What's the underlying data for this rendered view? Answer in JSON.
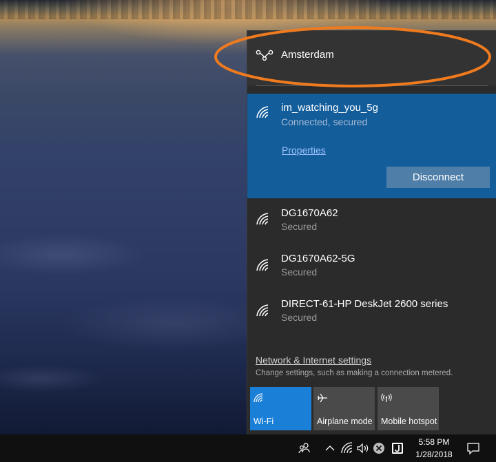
{
  "vpn": {
    "name": "Amsterdam",
    "icon": "vpn-icon"
  },
  "networks": [
    {
      "name": "im_watching_you_5g",
      "status": "Connected, secured",
      "properties_label": "Properties",
      "action_label": "Disconnect",
      "icon": "wifi-icon"
    },
    {
      "name": "DG1670A62",
      "status": "Secured",
      "icon": "wifi-icon"
    },
    {
      "name": "DG1670A62-5G",
      "status": "Secured",
      "icon": "wifi-icon"
    },
    {
      "name": "DIRECT-61-HP DeskJet 2600 series",
      "status": "Secured",
      "icon": "wifi-icon"
    }
  ],
  "settings": {
    "link": "Network & Internet settings",
    "description": "Change settings, such as making a connection metered."
  },
  "quick_actions": [
    {
      "label": "Wi-Fi",
      "icon": "wifi-icon",
      "state": "on"
    },
    {
      "label": "Airplane mode",
      "icon": "airplane-icon",
      "state": "off"
    },
    {
      "label": "Mobile hotspot",
      "icon": "hotspot-icon",
      "state": "off"
    }
  ],
  "taskbar": {
    "time": "5:58 PM",
    "date": "1/28/2018",
    "tray_icons": [
      "people-icon",
      "chevron-up-icon",
      "network-icon",
      "volume-icon",
      "x-circle-icon",
      "app-j-icon",
      "notification-icon"
    ]
  },
  "colors": {
    "flyout_bg": "#2b2b2b",
    "active_network_bg": "#135d9b",
    "wifi_tile_on": "#1a7fd6",
    "annotation": "#f07b1e",
    "taskbar_bg": "#101010"
  }
}
